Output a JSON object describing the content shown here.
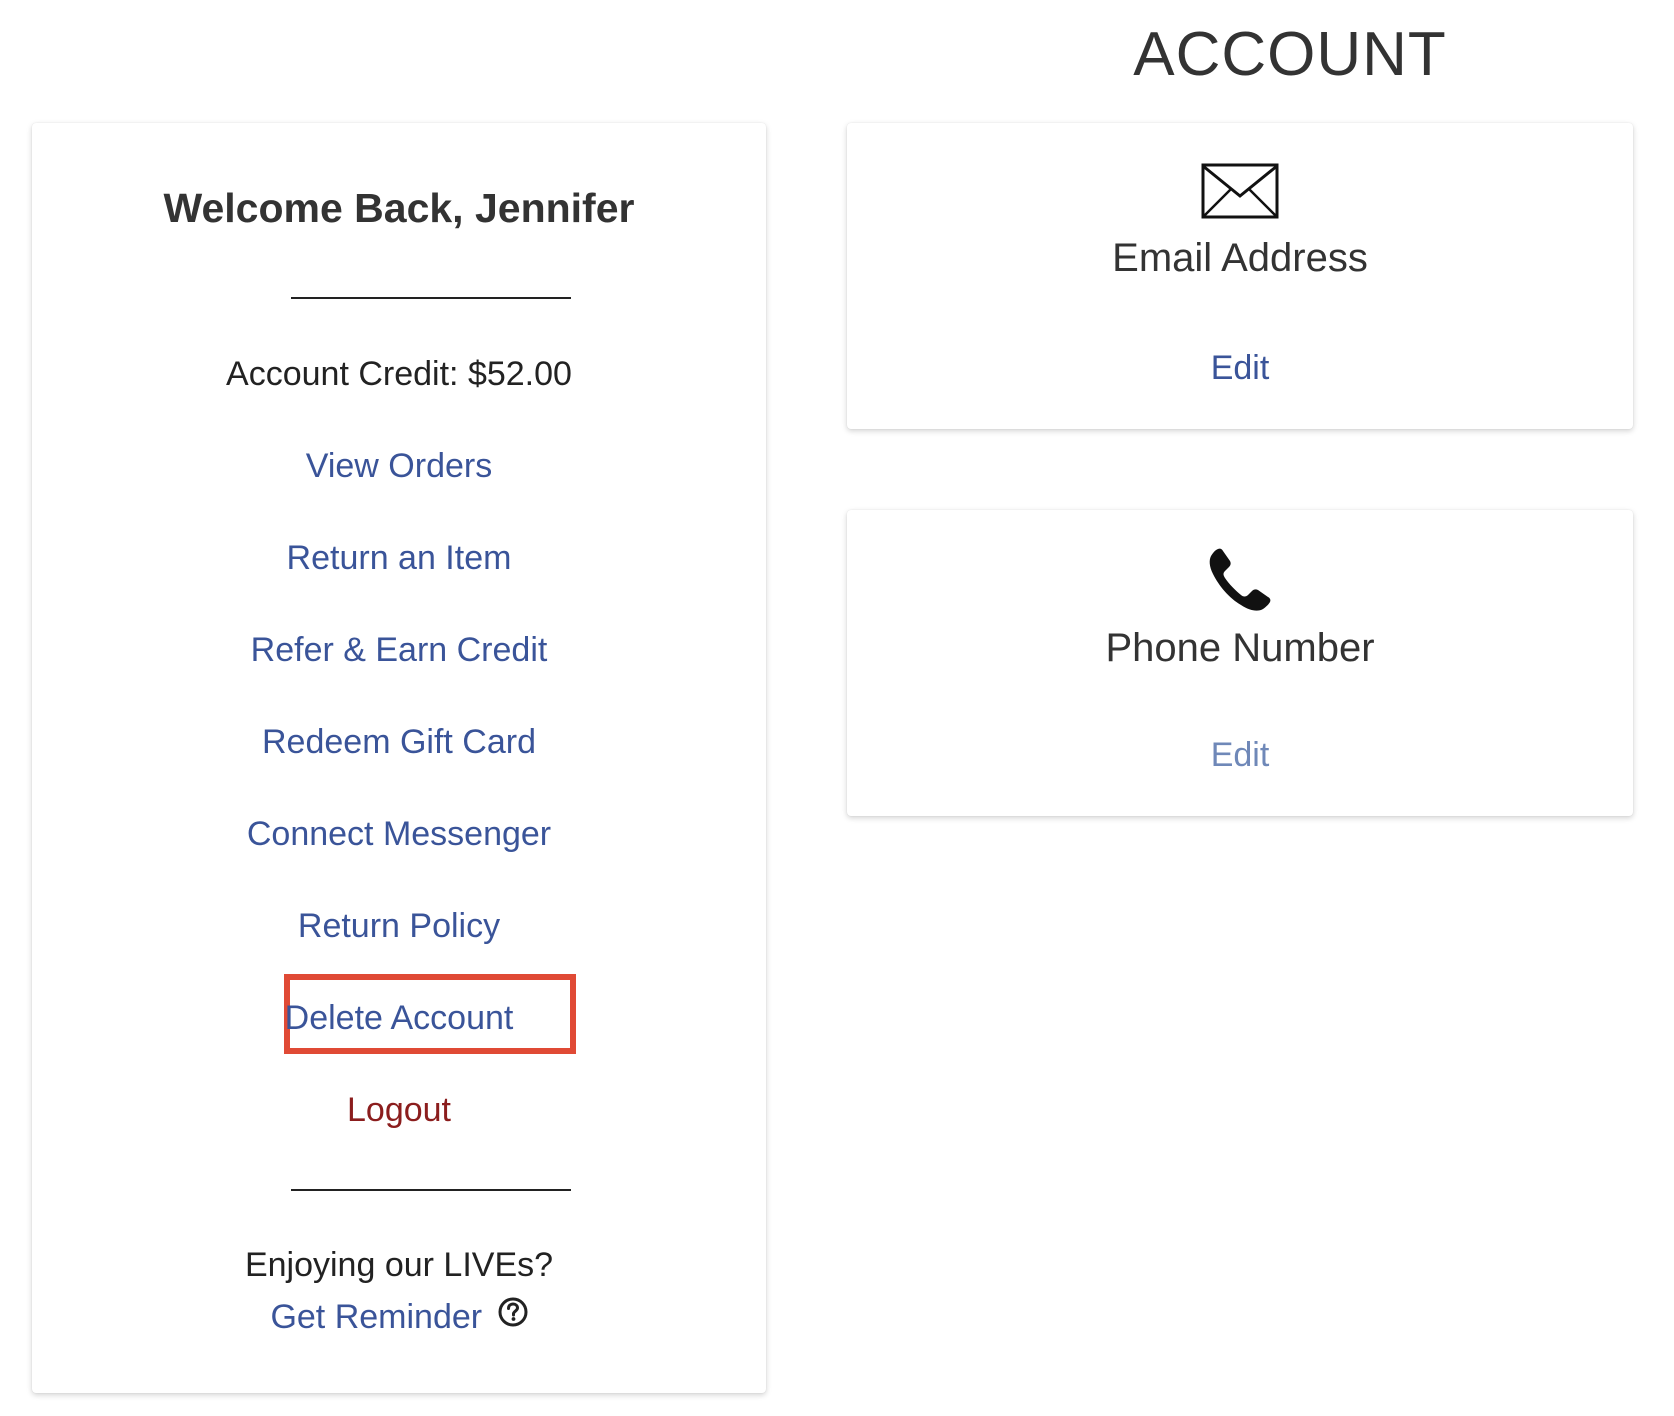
{
  "page": {
    "title": "ACCOUNT"
  },
  "sidebar": {
    "welcome": "Welcome Back, Jennifer",
    "credit_label": "Account Credit:",
    "credit_value": "$52.00",
    "links": [
      {
        "label": "View Orders"
      },
      {
        "label": "Return an Item"
      },
      {
        "label": "Refer & Earn Credit"
      },
      {
        "label": "Redeem Gift Card"
      },
      {
        "label": "Connect Messenger"
      },
      {
        "label": "Return Policy"
      },
      {
        "label": "Delete Account"
      },
      {
        "label": "Logout"
      }
    ],
    "enjoy_text": "Enjoying our LIVEs?",
    "reminder_label": "Get Reminder"
  },
  "cards": {
    "email": {
      "icon": "envelope-icon",
      "title": "Email Address",
      "edit_label": "Edit"
    },
    "phone": {
      "icon": "phone-icon",
      "title": "Phone Number",
      "edit_label": "Edit"
    }
  },
  "colors": {
    "link": "#3a5499",
    "logout": "#8b1d1d",
    "highlight": "#e04a35",
    "phone_edit": "#6f88b8"
  }
}
